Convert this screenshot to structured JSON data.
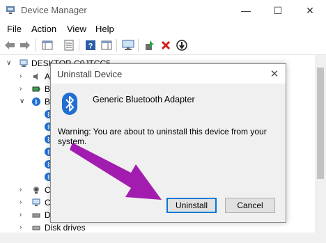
{
  "window": {
    "title": "Device Manager",
    "minimize_glyph": "—",
    "maximize_glyph": "☐",
    "close_glyph": "✕"
  },
  "menu": [
    "File",
    "Action",
    "View",
    "Help"
  ],
  "tree": {
    "root_label": "DESKTOP-C0JTCC5",
    "rows": [
      {
        "label": "A"
      },
      {
        "label": "B"
      },
      {
        "label": "B"
      },
      {
        "label": ""
      },
      {
        "label": ""
      },
      {
        "label": ""
      },
      {
        "label": ""
      },
      {
        "label": ""
      },
      {
        "label": ""
      },
      {
        "label": "C"
      },
      {
        "label": "C"
      },
      {
        "label": "D"
      },
      {
        "label": "Disk drives"
      }
    ]
  },
  "dialog": {
    "title": "Uninstall Device",
    "close_glyph": "✕",
    "device_name": "Generic Bluetooth Adapter",
    "warning": "Warning: You are about to uninstall this device from your system.",
    "uninstall_label": "Uninstall",
    "cancel_label": "Cancel"
  },
  "colors": {
    "accent": "#0078d7",
    "bluetooth": "#1f6fd1",
    "annotation_arrow": "#a21caf"
  },
  "icons": [
    "device-manager-icon",
    "back-arrow-icon",
    "forward-arrow-icon",
    "properties-icon",
    "help-icon",
    "scan-hardware-icon",
    "monitor-icon",
    "update-driver-icon",
    "uninstall-icon",
    "disable-icon",
    "bluetooth-icon"
  ]
}
